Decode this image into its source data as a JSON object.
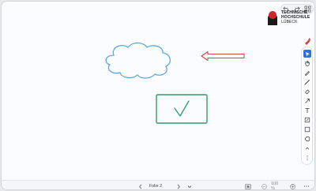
{
  "toolbar": {
    "icons": [
      "undo-icon",
      "redo-icon",
      "grid-icon"
    ]
  },
  "logo": {
    "line1": "TECHNISCHE",
    "line2": "HOCHSCHULE",
    "line3": "LÜBECK",
    "color_red": "#d2232a",
    "color_dark": "#1b1b1b"
  },
  "rail": {
    "top_tool": "tool-settings-icon",
    "tools": [
      "select",
      "hand",
      "pen",
      "pencil",
      "eraser",
      "arrow",
      "text",
      "sticky-note",
      "rectangle",
      "shape",
      "collapse",
      "more"
    ],
    "active_tool": "select",
    "accent": "#2f6fde"
  },
  "canvas": {
    "shapes": [
      {
        "kind": "cloud",
        "stroke": "#5aa9e6"
      },
      {
        "kind": "arrow-left",
        "stroke": "#d64545"
      },
      {
        "kind": "check-box",
        "stroke": "#2e9a6a"
      }
    ]
  },
  "bottom": {
    "page_label": "Folie 2",
    "zoom": "100 %",
    "icons": [
      "prev-page-icon",
      "next-page-icon",
      "page-dropdown-icon",
      "fit-icon",
      "zoom-out-icon",
      "zoom-in-icon",
      "more-icon"
    ]
  }
}
